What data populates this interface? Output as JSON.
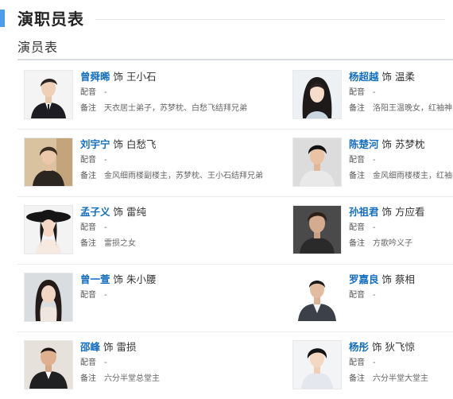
{
  "section": {
    "title": "演职员表"
  },
  "subsection": {
    "title": "演员表"
  },
  "labels": {
    "play_as": "饰",
    "dub": "配音",
    "note": "备注"
  },
  "colors": {
    "accent": "#4f9cee",
    "actor_link": "#136ec2"
  },
  "cast": [
    {
      "actor": "曾舜晞",
      "role": "王小石",
      "dub": "-",
      "note": "天衣居士弟子，苏梦枕、白愁飞结拜兄弟"
    },
    {
      "actor": "杨超越",
      "role": "温柔",
      "dub": "-",
      "note": "洛阳王温晚女，红袖神尼"
    },
    {
      "actor": "刘宇宁",
      "role": "白愁飞",
      "dub": "-",
      "note": "金风细雨楼副楼主，苏梦枕、王小石结拜兄弟"
    },
    {
      "actor": "陈楚河",
      "role": "苏梦枕",
      "dub": "-",
      "note": "金风细雨楼楼主，红袖神"
    },
    {
      "actor": "孟子义",
      "role": "雷纯",
      "dub": "-",
      "note": "雷损之女"
    },
    {
      "actor": "孙祖君",
      "role": "方应看",
      "dub": "-",
      "note": "方歌吟义子"
    },
    {
      "actor": "曾一萱",
      "role": "朱小腰",
      "dub": "-",
      "note": ""
    },
    {
      "actor": "罗嘉良",
      "role": "蔡相",
      "dub": "-",
      "note": ""
    },
    {
      "actor": "邵峰",
      "role": "雷损",
      "dub": "-",
      "note": "六分半堂总堂主"
    },
    {
      "actor": "杨彤",
      "role": "狄飞惊",
      "dub": "-",
      "note": "六分半堂大堂主"
    }
  ]
}
